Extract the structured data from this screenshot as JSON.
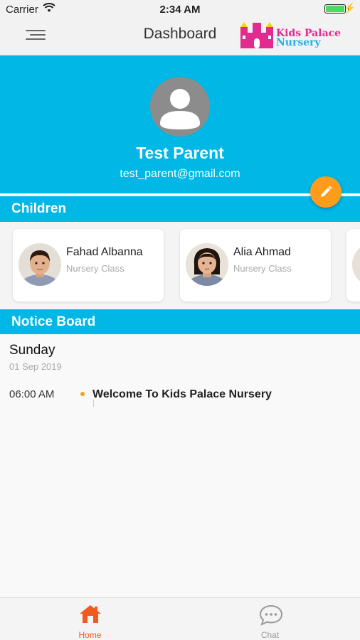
{
  "status_bar": {
    "carrier": "Carrier",
    "time": "2:34 AM",
    "battery_percent": 100
  },
  "nav": {
    "title": "Dashboard",
    "logo_line1": "Kids Palace",
    "logo_line2": "Nursery"
  },
  "profile": {
    "name": "Test Parent",
    "email": "test_parent@gmail.com"
  },
  "sections": {
    "children": "Children",
    "notice_board": "Notice Board"
  },
  "children": [
    {
      "name": "Fahad Albanna",
      "class": "Nursery Class"
    },
    {
      "name": "Alia Ahmad",
      "class": "Nursery Class"
    }
  ],
  "notices": {
    "day": "Sunday",
    "date": "01 Sep 2019",
    "items": [
      {
        "time": "06:00 AM",
        "title": "Welcome To Kids Palace Nursery"
      }
    ]
  },
  "tabs": [
    {
      "label": "Home",
      "icon": "home-icon",
      "active": true
    },
    {
      "label": "Chat",
      "icon": "chat-icon",
      "active": false
    }
  ],
  "colors": {
    "primary": "#00b7e5",
    "accent": "#ff9c1b",
    "active_tab": "#f05a1e"
  }
}
